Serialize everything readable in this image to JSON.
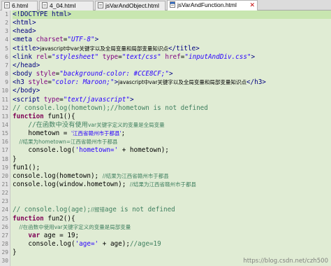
{
  "tabs": [
    {
      "label": "6.html"
    },
    {
      "label": "4_04.html"
    },
    {
      "label": "jsVarAndObject.html"
    },
    {
      "label": "jsVarAndFunction.html",
      "active": true,
      "close": "✕"
    }
  ],
  "gutter": {
    "line_numbers": [
      "1",
      "2",
      "3",
      "4",
      "5",
      "6",
      "7",
      "8",
      "9",
      "10",
      "11",
      "12",
      "13",
      "14",
      "15",
      "16",
      "17",
      "18",
      "19",
      "20",
      "21",
      "22",
      "23",
      "24",
      "25",
      "26",
      "27",
      "28",
      "29",
      "30"
    ]
  },
  "code": {
    "l1": "<!DOCTYPE html>",
    "l2": "<html>",
    "l3": "<head>",
    "l4_a": "<meta ",
    "l4_b": "charset",
    "l4_c": "=",
    "l4_d": "\"UTF-8\"",
    "l4_e": ">",
    "l5_a": "<title>",
    "l5_b": "javascript中var关键字以及全局变量和局部变量知识点",
    "l5_c": "</title>",
    "l6_a": "<link ",
    "l6_b": "rel",
    "l6_c": "=",
    "l6_d": "\"stylesheet\"",
    "l6_e": " type",
    "l6_f": "=",
    "l6_g": "\"text/css\"",
    "l6_h": " href",
    "l6_i": "=",
    "l6_j": "\"inputAndDiv.css\"",
    "l6_k": ">",
    "l7": "</head>",
    "l8_a": "<body ",
    "l8_b": "style",
    "l8_c": "=",
    "l8_d": "\"background-color: #CCE8CF;\"",
    "l8_e": ">",
    "l9_a": "<h3 ",
    "l9_b": "style",
    "l9_c": "=",
    "l9_d": "\"color: Maroon;\"",
    "l9_e": ">",
    "l9_f": "javascript中var关键字以及全局变量和局部变量知识点",
    "l9_g": "</h3>",
    "l10": "</body>",
    "l11_a": "<script ",
    "l11_b": "type",
    "l11_c": "=",
    "l11_d": "\"text/javascript\"",
    "l11_e": ">",
    "l12": "// console.log(hometown);//hometown is not defined",
    "l13_a": "function",
    "l13_b": " fun1(){",
    "l14_a": "    //在函数中没有使用",
    "l14_b": "var关键字定义的变量是全局变量",
    "l15_a": "    hometown = ",
    "l15_b": "'江西省赣州市于都县'",
    "l15_c": ";",
    "l16_a": "    //结果为",
    "l16_b": "hometown=江西省赣州市于都县",
    "l17_a": "    console.log(",
    "l17_b": "'hometown='",
    "l17_c": " + hometown);",
    "l18": "}",
    "l19": "fun1();",
    "l20_a": "console.log(hometown); ",
    "l20_b": "//结果为江西省赣州市于都县",
    "l21_a": "console.log(window.hometown); ",
    "l21_b": "//结果为江西省赣州市于都县",
    "l22": "",
    "l23": "",
    "l24_a": "// console.log(age);",
    "l24_b": "//报错",
    "l24_c": "age is not defined",
    "l25_a": "function",
    "l25_b": " fun2(){",
    "l26_a": "    //在函数中使用",
    "l26_b": "var关键字定义的变量是局部变量",
    "l27_a": "    ",
    "l27_b": "var",
    "l27_c": " age = 19;",
    "l28_a": "    console.log(",
    "l28_b": "'age='",
    "l28_c": " + age);",
    "l28_d": "//age=19",
    "l29": "}",
    "l30": ""
  },
  "watermark": "https://blog.csdn.net/czh500"
}
